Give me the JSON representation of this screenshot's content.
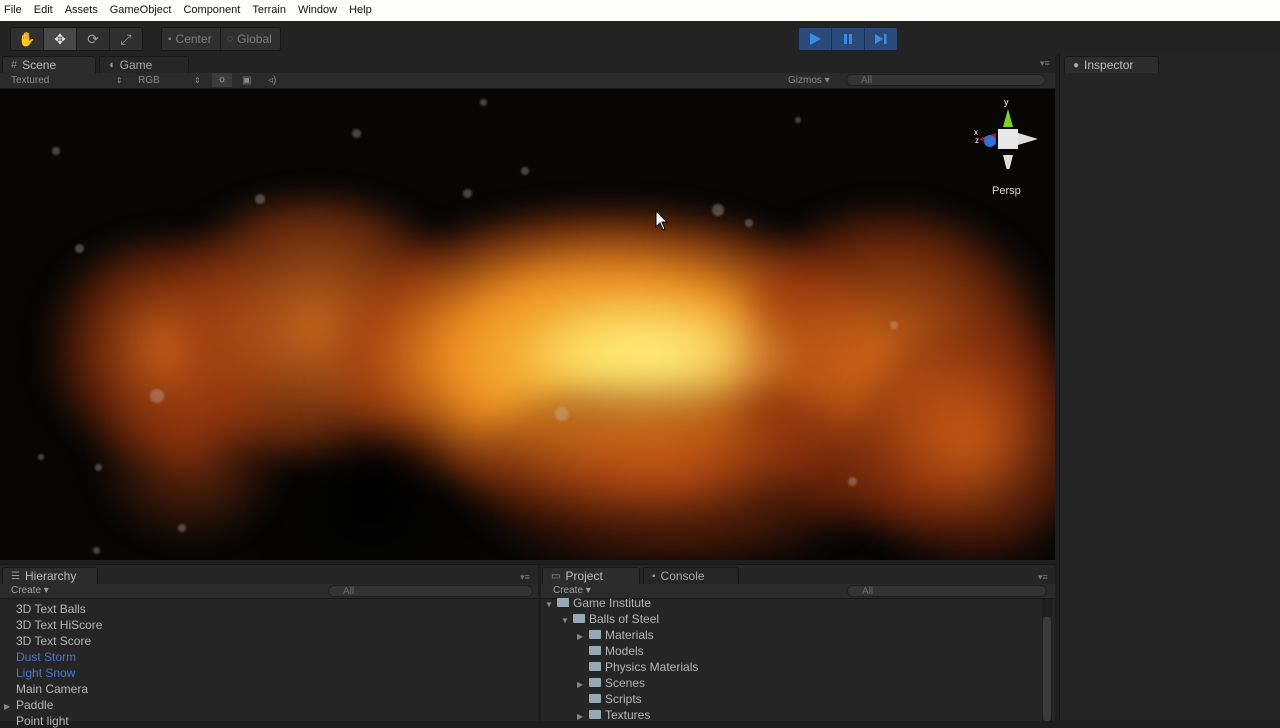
{
  "menu": [
    "File",
    "Edit",
    "Assets",
    "GameObject",
    "Component",
    "Terrain",
    "Window",
    "Help"
  ],
  "toolbar": {
    "tools": [
      {
        "name": "hand-icon",
        "glyph": "✋"
      },
      {
        "name": "move-icon",
        "glyph": "✥"
      },
      {
        "name": "rotate-icon",
        "glyph": "⟳"
      },
      {
        "name": "scale-icon",
        "glyph": "⤢"
      }
    ],
    "pivot_label": "Center",
    "space_label": "Global",
    "accent": "#2a4a7a",
    "play_color": "#3d8be0"
  },
  "scene": {
    "tab_scene": "Scene",
    "tab_game": "Game",
    "render_mode": "Textured",
    "color_mode": "RGB",
    "gizmos_label": "Gizmos",
    "search_placeholder": "All",
    "gizmo_y": "y",
    "gizmo_x": "x",
    "gizmo_z": "z",
    "projection": "Persp"
  },
  "inspector": {
    "title": "Inspector"
  },
  "hierarchy": {
    "title": "Hierarchy",
    "create_label": "Create",
    "search_placeholder": "All",
    "items": [
      {
        "label": "3D Text Balls",
        "blue": false,
        "expandable": false
      },
      {
        "label": "3D Text HiScore",
        "blue": false,
        "expandable": false
      },
      {
        "label": "3D Text Score",
        "blue": false,
        "expandable": false
      },
      {
        "label": "Dust Storm",
        "blue": true,
        "expandable": false
      },
      {
        "label": "Light Snow",
        "blue": true,
        "expandable": false
      },
      {
        "label": "Main Camera",
        "blue": false,
        "expandable": false
      },
      {
        "label": "Paddle",
        "blue": false,
        "expandable": true
      },
      {
        "label": "Point light",
        "blue": false,
        "expandable": false
      }
    ]
  },
  "project": {
    "title": "Project",
    "console_tab": "Console",
    "create_label": "Create",
    "search_placeholder": "All",
    "tree": [
      {
        "label": "Game Institute",
        "depth": 0,
        "arrow": "expanded"
      },
      {
        "label": "Balls of Steel",
        "depth": 1,
        "arrow": "expanded"
      },
      {
        "label": "Materials",
        "depth": 2,
        "arrow": "collapsed"
      },
      {
        "label": "Models",
        "depth": 2,
        "arrow": "none"
      },
      {
        "label": "Physics Materials",
        "depth": 2,
        "arrow": "none"
      },
      {
        "label": "Scenes",
        "depth": 2,
        "arrow": "collapsed"
      },
      {
        "label": "Scripts",
        "depth": 2,
        "arrow": "none"
      },
      {
        "label": "Textures",
        "depth": 2,
        "arrow": "collapsed"
      }
    ]
  }
}
